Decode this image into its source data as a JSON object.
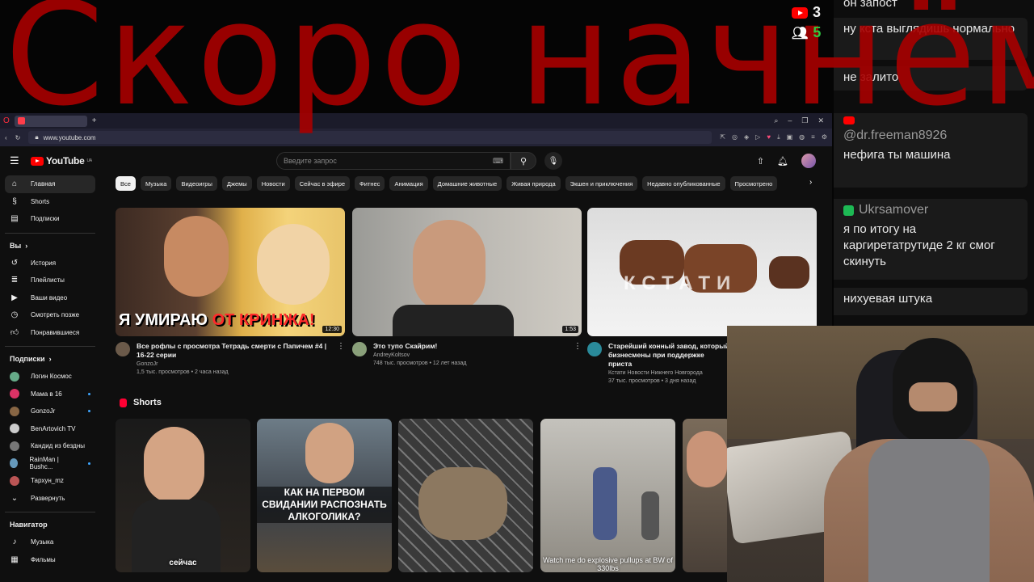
{
  "overlay": {
    "title": "Скоро начнём",
    "youtube_viewers": "3",
    "total_viewers": "5"
  },
  "browser": {
    "url": "www.youtube.com"
  },
  "youtube": {
    "search_placeholder": "Введите запрос",
    "sidebar": {
      "main": [
        {
          "label": "Главная",
          "icon": "home-icon"
        },
        {
          "label": "Shorts",
          "icon": "shorts-icon"
        },
        {
          "label": "Подписки",
          "icon": "subscriptions-icon"
        }
      ],
      "you_header": "Вы",
      "you": [
        {
          "label": "История",
          "icon": "history-icon"
        },
        {
          "label": "Плейлисты",
          "icon": "playlist-icon"
        },
        {
          "label": "Ваши видео",
          "icon": "video-icon"
        },
        {
          "label": "Смотреть позже",
          "icon": "clock-icon"
        },
        {
          "label": "Понравившиеся",
          "icon": "thumbs-up-icon"
        }
      ],
      "subs_header": "Подписки",
      "subs": [
        {
          "label": "Логин Космос",
          "color": "#6a8"
        },
        {
          "label": "Мама в 16",
          "color": "#d36"
        },
        {
          "label": "GonzoJr",
          "color": "#864"
        },
        {
          "label": "BenArtovich TV",
          "color": "#ccc"
        },
        {
          "label": "Кандид из бездны",
          "color": "#777"
        },
        {
          "label": "RainMan | Bushc...",
          "color": "#69b"
        },
        {
          "label": "Тархун_mz",
          "color": "#b55"
        }
      ],
      "expand": "Развернуть",
      "nav_header": "Навигатор",
      "nav": [
        {
          "label": "Музыка",
          "icon": "music-icon"
        },
        {
          "label": "Фильмы",
          "icon": "film-icon"
        }
      ]
    },
    "chips": [
      "Все",
      "Музыка",
      "Видеоигры",
      "Джемы",
      "Новости",
      "Сейчас в эфире",
      "Фитнес",
      "Анимация",
      "Домашние животные",
      "Живая природа",
      "Экшен и приключения",
      "Недавно опубликованные",
      "Просмотрено"
    ],
    "videos": [
      {
        "title": "Все рофлы с просмотра Тетрадь смерти с Папичем #4 | 16-22 серии",
        "channel": "GonzoJr",
        "stats": "1,5 тыс. просмотров • 2 часа назад",
        "duration": "12:30",
        "thumb_text_1": "Я УМИРАЮ",
        "thumb_text_2": "ОТ КРИНЖА!"
      },
      {
        "title": "Это тупо Скайрим!",
        "channel": "AndreyKoltsov",
        "stats": "748 тыс. просмотров • 12 лет назад",
        "duration": "1:53"
      },
      {
        "title": "Старейший конный завод, который бизнесмены при поддержке приста",
        "channel": "Кстати Новости Нижнего Новгорода",
        "stats": "37 тыс. просмотров • 3 дня назад",
        "duration": "",
        "thumb_text_1": "КСТАТИ"
      }
    ],
    "shorts_label": "Shorts",
    "shorts": [
      {
        "caption": "сейчас"
      },
      {
        "caption": "КАК НА ПЕРВОМ СВИДАНИИ РАСПОЗНАТЬ АЛКОГОЛИКА?"
      },
      {
        "caption": ""
      },
      {
        "caption": "Watch me do explosive pullups at BW of 330lbs"
      },
      {
        "caption": ""
      }
    ]
  },
  "chat": [
    {
      "user": "",
      "text": "он запост",
      "platform": ""
    },
    {
      "user": "",
      "text": "ну кста выглядишь нормально",
      "platform": ""
    },
    {
      "user": "",
      "text": "не залито",
      "platform": ""
    },
    {
      "user": "",
      "text": "",
      "platform": "youtube"
    },
    {
      "user": "@dr.freeman8926",
      "text": "нефига ты машина",
      "platform": "youtube"
    },
    {
      "user": "Ukrsamover",
      "text": "я по итогу на каргиретатрутиде 2 кг смог скинуть",
      "platform": "other"
    },
    {
      "user": "",
      "text": "нихуевая штука",
      "platform": ""
    }
  ]
}
